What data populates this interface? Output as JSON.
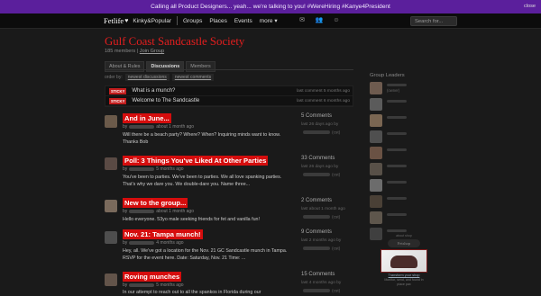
{
  "announcement": {
    "text": "Calling all Product Designers... yeah... we're talking to you! #WereHiring #Kanye4President",
    "close_label": "close"
  },
  "topbar": {
    "logo": "Fetlife",
    "community": "Kinky&Popular",
    "nav": [
      "Groups",
      "Places",
      "Events",
      "more ▾"
    ],
    "search_placeholder": "Search for..."
  },
  "group": {
    "title": "Gulf Coast Sandcastle Society",
    "members": "185 members",
    "join": "Join Group"
  },
  "tabs": [
    "About & Rules",
    "Discussions",
    "Members"
  ],
  "order": {
    "label": "order by:",
    "options": [
      "newest discussions",
      "newest comments"
    ]
  },
  "stickies": [
    {
      "tag": "STICKY",
      "title": "What is a munch?",
      "meta": "last comment 5 months ago"
    },
    {
      "tag": "STICKY",
      "title": "Welcome to The Sandcastle",
      "meta": "last comment 6 months ago"
    }
  ],
  "discussions": [
    {
      "title": "And in June...",
      "by_prefix": "by",
      "when": "about 1 month ago",
      "excerpt": "Will there be a beach party? Where? When? Inquiring minds want to know. Thanks Bob",
      "comments": "5 Comments",
      "last": "last 26 days ago by",
      "last_suffix": "(cst)",
      "thumb": "#6b5a4a"
    },
    {
      "title": "Poll: 3 Things You've Liked At Other Parties",
      "by_prefix": "by",
      "when": "5 months ago",
      "excerpt": "You've been to parties. We've been to parties. We all love spanking parties. That's why we dare you. We double-dare you. Name three...",
      "comments": "33 Comments",
      "last": "last 26 days ago by",
      "last_suffix": "(cst)",
      "thumb": "#5a4a44"
    },
    {
      "title": "New to the group...",
      "by_prefix": "by",
      "when": "about 1 month ago",
      "excerpt": "Hello everyone. 53yo male seeking friends for fet and vanilla fun!",
      "comments": "2 Comments",
      "last": "last about 1 month ago",
      "last_suffix": "(cst)",
      "thumb": "#7a6a5c"
    },
    {
      "title": "Nov. 21: Tampa munch!",
      "by_prefix": "by",
      "when": "4 months ago",
      "excerpt": "Hey, all. We've got a location for the Nov. 21 GC Sandcastle munch in Tampa. RSVP for the event here. Date: Saturday, Nov. 21 Time: ...",
      "comments": "9 Comments",
      "last": "last 2 months ago by",
      "last_suffix": "(cst)",
      "thumb": "#4e4e4e"
    },
    {
      "title": "Roving munches",
      "by_prefix": "by",
      "when": "5 months ago",
      "excerpt": "In our attempt to reach out to all the spankos in Florida during our",
      "comments": "15 Comments",
      "last": "last 4 months ago by",
      "last_suffix": "(cst)",
      "thumb": "#63544a"
    }
  ],
  "sidebar": {
    "heading": "Group Leaders",
    "leaders": [
      {
        "sub": "(owner)",
        "color": "#6e5b4f"
      },
      {
        "sub": "",
        "color": "#5b5b5b"
      },
      {
        "sub": "",
        "color": "#7a6652"
      },
      {
        "sub": "",
        "color": "#4f4f4f"
      },
      {
        "sub": "",
        "color": "#6a5244"
      },
      {
        "sub": "",
        "color": "#585048"
      },
      {
        "sub": "",
        "color": "#6c6c6c"
      },
      {
        "sub": "",
        "color": "#4a4036"
      },
      {
        "sub": "",
        "color": "#5e564c"
      },
      {
        "sub": "",
        "color": "#3f3f3f"
      }
    ]
  },
  "ad": {
    "label": "about shop",
    "logo": "Fetshop",
    "caption": "Transform your shop",
    "tagline": "Monitor, send, and found in place pax"
  }
}
